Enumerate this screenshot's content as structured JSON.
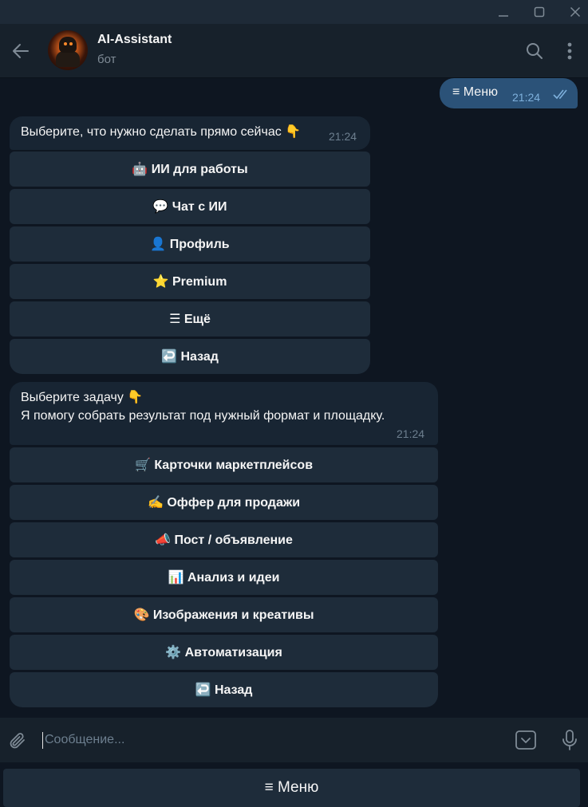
{
  "chat": {
    "title": "AI-Assistant",
    "subtitle": "бот"
  },
  "outgoing": {
    "text": "≡ Меню",
    "time": "21:24"
  },
  "message1": {
    "text": "Выберите, что нужно сделать прямо сейчас 👇",
    "time": "21:24",
    "buttons": [
      "🤖 ИИ для работы",
      "💬 Чат с ИИ",
      "👤 Профиль",
      "⭐ Premium",
      "☰ Ещё",
      "↩️ Назад"
    ]
  },
  "message2": {
    "line1": "Выберите задачу 👇",
    "line2": "Я помогу собрать результат под нужный формат и площадку.",
    "time": "21:24",
    "buttons": [
      "🛒 Карточки маркетплейсов",
      "✍️ Оффер для продажи",
      "📣 Пост / объявление",
      "📊 Анализ и идеи",
      "🎨 Изображения и креативы",
      "⚙️ Автоматизация",
      "↩️ Назад"
    ]
  },
  "composer": {
    "placeholder": "Сообщение..."
  },
  "reply_keyboard": {
    "menu_label": "≡ Меню"
  },
  "icons": {
    "back": "arrow-left-icon",
    "search": "search-icon",
    "more": "more-vertical-icon",
    "attach": "paperclip-icon",
    "keyboard": "keyboard-toggle-icon",
    "mic": "microphone-icon"
  },
  "colors": {
    "background": "#0e1621",
    "header": "#17212b",
    "incoming_bubble": "#182533",
    "outgoing_bubble": "#2b5278",
    "keyboard_button": "#1e2c3a",
    "read_ticks": "#7eb0dc"
  }
}
